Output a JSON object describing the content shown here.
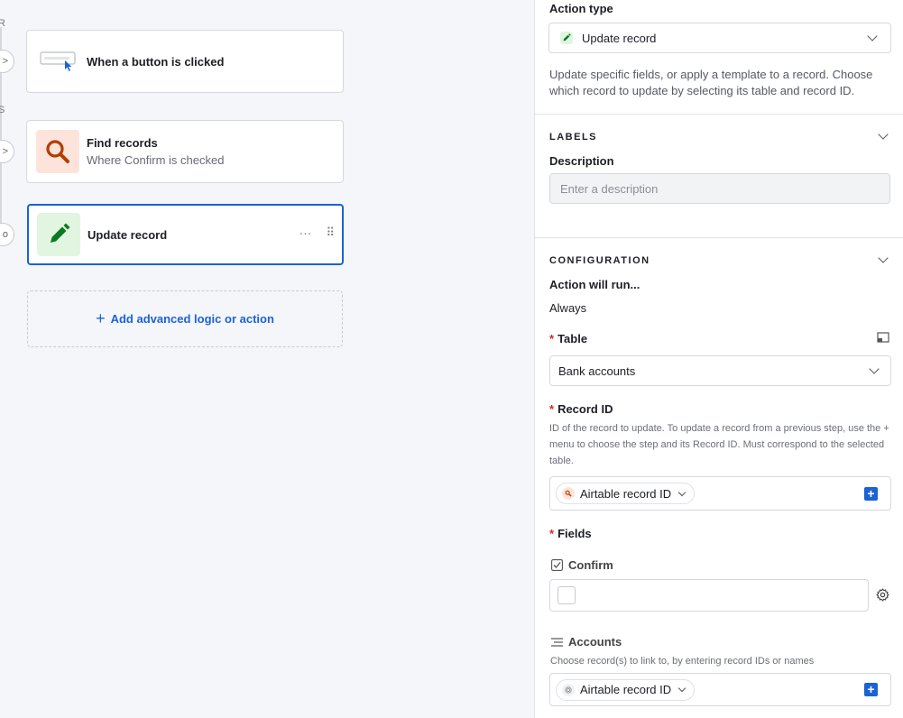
{
  "canvas": {
    "rail_letters": [
      "R",
      "S"
    ],
    "rail_nodes": [
      ">",
      ">",
      "o"
    ],
    "trigger": {
      "title": "When a button is clicked"
    },
    "find_step": {
      "title": "Find records",
      "subtitle": "Where Confirm is checked"
    },
    "update_step": {
      "title": "Update record",
      "more": "···",
      "drag": "⠿"
    },
    "add_action": {
      "plus": "+",
      "label": "Add advanced logic or action"
    }
  },
  "panel": {
    "action_type": {
      "label": "Action type",
      "value": "Update record",
      "icon": "pencil-icon",
      "description": "Update specific fields, or apply a template to a record. Choose which record to update by selecting its table and record ID."
    },
    "labels_section": {
      "title": "LABELS",
      "description_label": "Description",
      "description_placeholder": "Enter a description"
    },
    "configuration": {
      "title": "CONFIGURATION",
      "run_label": "Action will run...",
      "run_value": "Always",
      "table": {
        "required": "*",
        "label": "Table",
        "value": "Bank accounts"
      },
      "record_id": {
        "required": "*",
        "label": "Record ID",
        "help": "ID of the record to update. To update a record from a previous step, use the + menu to choose the step and its Record ID. Must correspond to the selected table.",
        "token": "Airtable record ID"
      },
      "fields": {
        "required": "*",
        "label": "Fields",
        "confirm_label": "Confirm",
        "accounts_label": "Accounts",
        "accounts_help": "Choose record(s) to link to, by entering record IDs or names",
        "accounts_token": "Airtable record ID"
      }
    }
  },
  "colors": {
    "accent": "#1b63d1",
    "find": "#b53c00",
    "update": "#0b7a1f",
    "required": "#d02a2a"
  }
}
